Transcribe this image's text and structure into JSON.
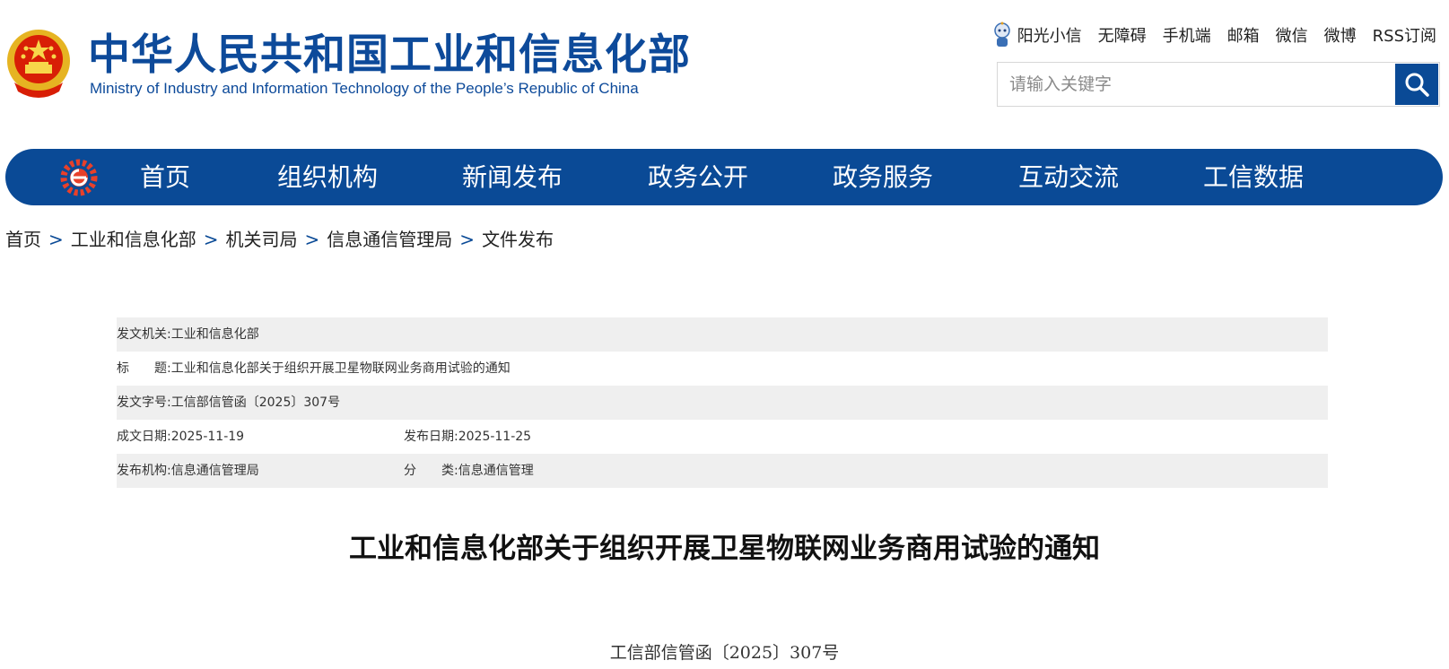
{
  "header": {
    "title_cn": "中华人民共和国工业和信息化部",
    "title_en": "Ministry of Industry and Information Technology of the People’s Republic of China",
    "emblem_icon": "national-emblem-icon",
    "brand_color": "#0a4a96",
    "top_links": [
      "阳光小信",
      "无障碍",
      "手机端",
      "邮箱",
      "微信",
      "微博",
      "RSS订阅"
    ],
    "search": {
      "placeholder": "请输入关键字",
      "value": ""
    }
  },
  "nav": {
    "items": [
      "首页",
      "组织机构",
      "新闻发布",
      "政务公开",
      "政务服务",
      "互动交流",
      "工信数据"
    ]
  },
  "breadcrumb": {
    "items": [
      "首页",
      "工业和信息化部",
      "机关司局",
      "信息通信管理局",
      "文件发布"
    ],
    "separator": ">"
  },
  "info": {
    "issuer_label": "发文机关:",
    "issuer": "工业和信息化部",
    "title_label": "标　　题:",
    "title": "工业和信息化部关于组织开展卫星物联网业务商用试验的通知",
    "doc_no_label": "发文字号:",
    "doc_no": "工信部信管函〔2025〕307号",
    "written_date_label": "成文日期:",
    "written_date": "2025-11-19",
    "publish_date_label": "发布日期:",
    "publish_date": "2025-11-25",
    "publisher_label": "发布机构:",
    "publisher": "信息通信管理局",
    "category_label": "分　　类:",
    "category": "信息通信管理"
  },
  "document": {
    "title": "工业和信息化部关于组织开展卫星物联网业务商用试验的通知",
    "number": "工信部信管函〔2025〕307号"
  }
}
